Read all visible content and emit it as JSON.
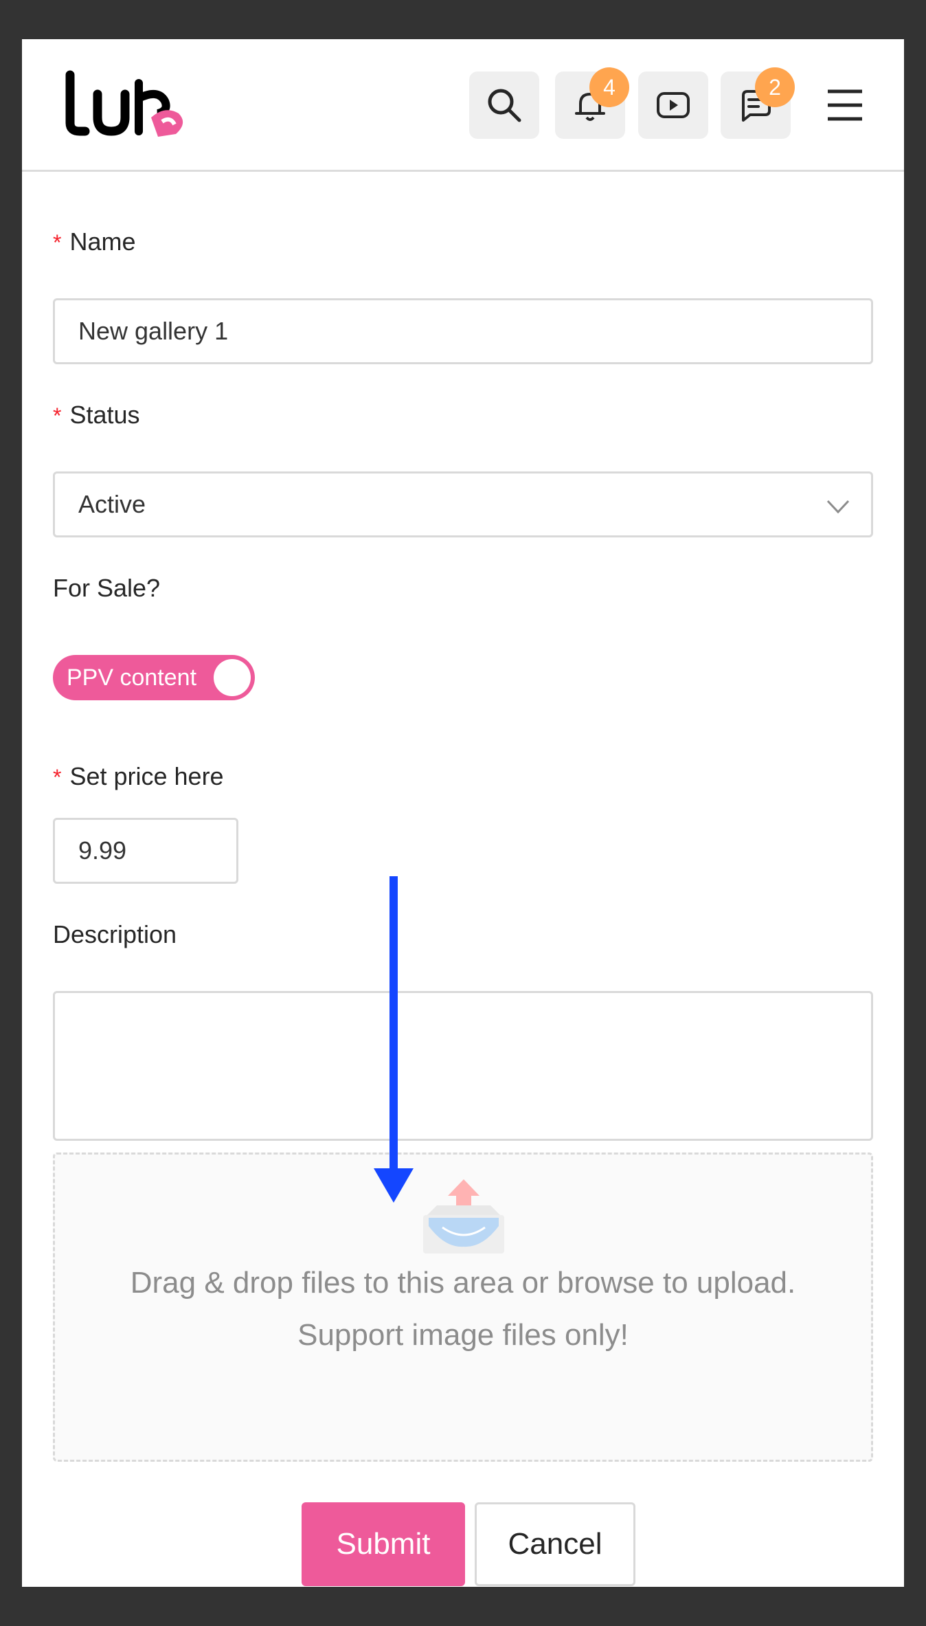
{
  "header": {
    "notifications_count": "4",
    "messages_count": "2"
  },
  "form": {
    "name_label": "Name",
    "name_value": "New gallery 1",
    "status_label": "Status",
    "status_value": "Active",
    "for_sale_label": "For Sale?",
    "toggle_label": "PPV content",
    "price_label": "Set price here",
    "price_value": "9.99",
    "description_label": "Description",
    "description_value": "",
    "required_marker": "*"
  },
  "upload": {
    "line1": "Drag & drop files to this area or browse to upload.",
    "line2": "Support image files only!"
  },
  "actions": {
    "submit_label": "Submit",
    "cancel_label": "Cancel"
  },
  "colors": {
    "brand_pink": "#ee5a9a",
    "badge_orange": "#ffa54f",
    "annotation_arrow": "#1446ff"
  }
}
